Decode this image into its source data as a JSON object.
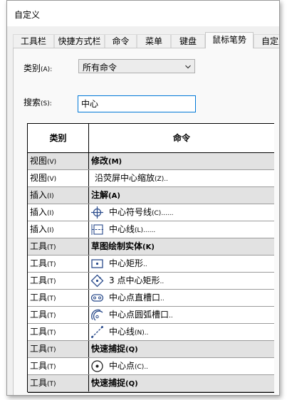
{
  "window": {
    "title": "自定义"
  },
  "tabs": [
    {
      "label": "工具栏",
      "active": false
    },
    {
      "label": "快捷方式栏",
      "active": false
    },
    {
      "label": "命令",
      "active": false
    },
    {
      "label": "菜单",
      "active": false
    },
    {
      "label": "键盘",
      "active": false
    },
    {
      "label": "鼠标笔势",
      "active": true
    },
    {
      "label": "自定义",
      "active": false
    }
  ],
  "category": {
    "label": "类别",
    "key": "(A):",
    "value": "所有命令"
  },
  "search": {
    "label": "搜索",
    "key": "(S):",
    "value": "中心"
  },
  "table": {
    "headers": {
      "category": "类别",
      "command": "命令"
    },
    "rows": [
      {
        "cat": "视图",
        "key": "(V)",
        "cmd": "修改",
        "cmdkey": "(M)",
        "group": true
      },
      {
        "cat": "视图",
        "key": "(V)",
        "cmd": "沿荧屏中心缩放",
        "cmdkey": "(Z)..",
        "icon": "none"
      },
      {
        "cat": "插入",
        "key": "(I)",
        "cmd": "注解",
        "cmdkey": "(A)",
        "group": true
      },
      {
        "cat": "插入",
        "key": "(I)",
        "cmd": "中心符号线",
        "cmdkey": "(C)......",
        "icon": "center-mark-icon"
      },
      {
        "cat": "插入",
        "key": "(I)",
        "cmd": "中心线",
        "cmdkey": "(L)......",
        "icon": "centerline-icon"
      },
      {
        "cat": "工具",
        "key": "(T)",
        "cmd": "草图绘制实体",
        "cmdkey": "(K)",
        "group": true
      },
      {
        "cat": "工具",
        "key": "(T)",
        "cmd": "中心矩形",
        "cmdkey": "..",
        "icon": "center-rectangle-icon"
      },
      {
        "cat": "工具",
        "key": "(T)",
        "cmd": "3 点中心矩形",
        "cmdkey": "..",
        "icon": "three-point-center-rectangle-icon"
      },
      {
        "cat": "工具",
        "key": "(T)",
        "cmd": "中心点直槽口",
        "cmdkey": "..",
        "icon": "straight-slot-icon"
      },
      {
        "cat": "工具",
        "key": "(T)",
        "cmd": "中心点圆弧槽口",
        "cmdkey": "..",
        "icon": "arc-slot-icon"
      },
      {
        "cat": "工具",
        "key": "(T)",
        "cmd": "中心线",
        "cmdkey": "(N)..",
        "icon": "sketch-centerline-icon"
      },
      {
        "cat": "工具",
        "key": "(T)",
        "cmd": "快速捕捉",
        "cmdkey": "(Q)",
        "group": true
      },
      {
        "cat": "工具",
        "key": "(T)",
        "cmd": "中心点",
        "cmdkey": "(C)..",
        "icon": "center-point-icon"
      },
      {
        "cat": "工具",
        "key": "(T)",
        "cmd": "快速捕捉",
        "cmdkey": "(Q)",
        "group": true
      }
    ]
  },
  "colors": {
    "accent": "#0078d7",
    "icon_blue": "#2b4c8c",
    "group_bg": "#e2e2e2"
  }
}
